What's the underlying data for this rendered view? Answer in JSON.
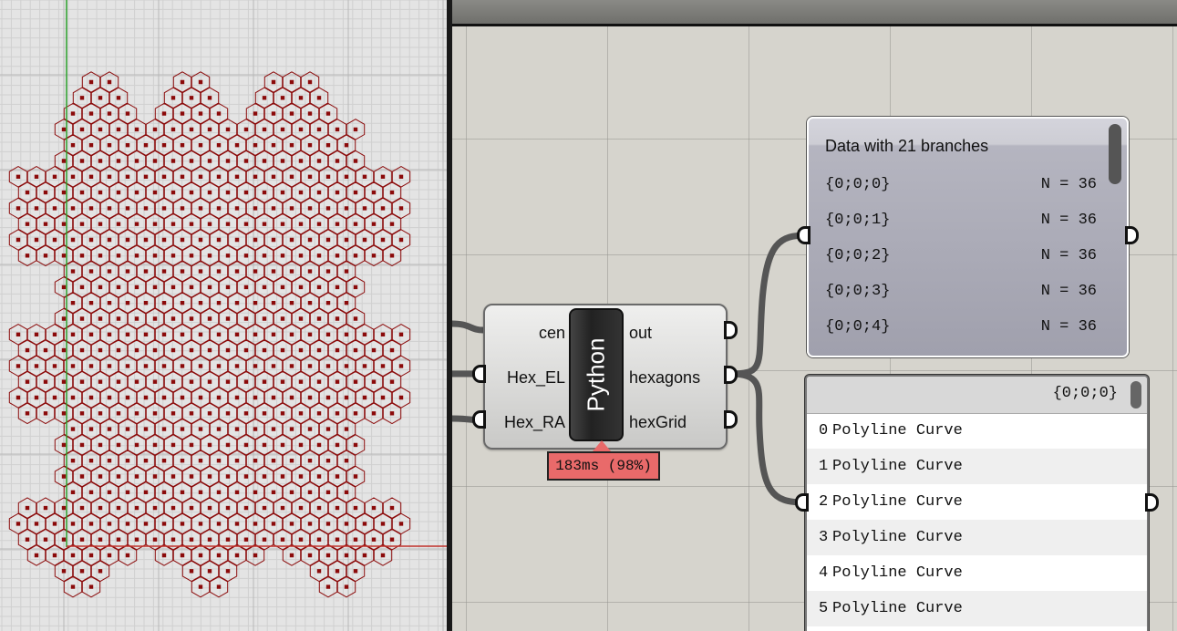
{
  "python_component": {
    "name": "Python",
    "inputs": [
      "cen",
      "Hex_EL",
      "Hex_RA"
    ],
    "outputs": [
      "out",
      "hexagons",
      "hexGrid"
    ],
    "timing": "183ms (98%)",
    "timing_color": "#e96a6a"
  },
  "data_panel": {
    "title": "Data with 21 branches",
    "rows": [
      {
        "path": "{0;0;0}",
        "count": "N = 36"
      },
      {
        "path": "{0;0;1}",
        "count": "N = 36"
      },
      {
        "path": "{0;0;2}",
        "count": "N = 36"
      },
      {
        "path": "{0;0;3}",
        "count": "N = 36"
      },
      {
        "path": "{0;0;4}",
        "count": "N = 36"
      }
    ]
  },
  "list_panel": {
    "branch": "{0;0;0}",
    "items": [
      {
        "index": "0",
        "value": "Polyline Curve"
      },
      {
        "index": "1",
        "value": "Polyline Curve"
      },
      {
        "index": "2",
        "value": "Polyline Curve"
      },
      {
        "index": "3",
        "value": "Polyline Curve"
      },
      {
        "index": "4",
        "value": "Polyline Curve"
      },
      {
        "index": "5",
        "value": "Polyline Curve"
      }
    ]
  },
  "viewport": {
    "hex_color": "#8b0a0a",
    "grid_bg": "#e4e4e4"
  }
}
